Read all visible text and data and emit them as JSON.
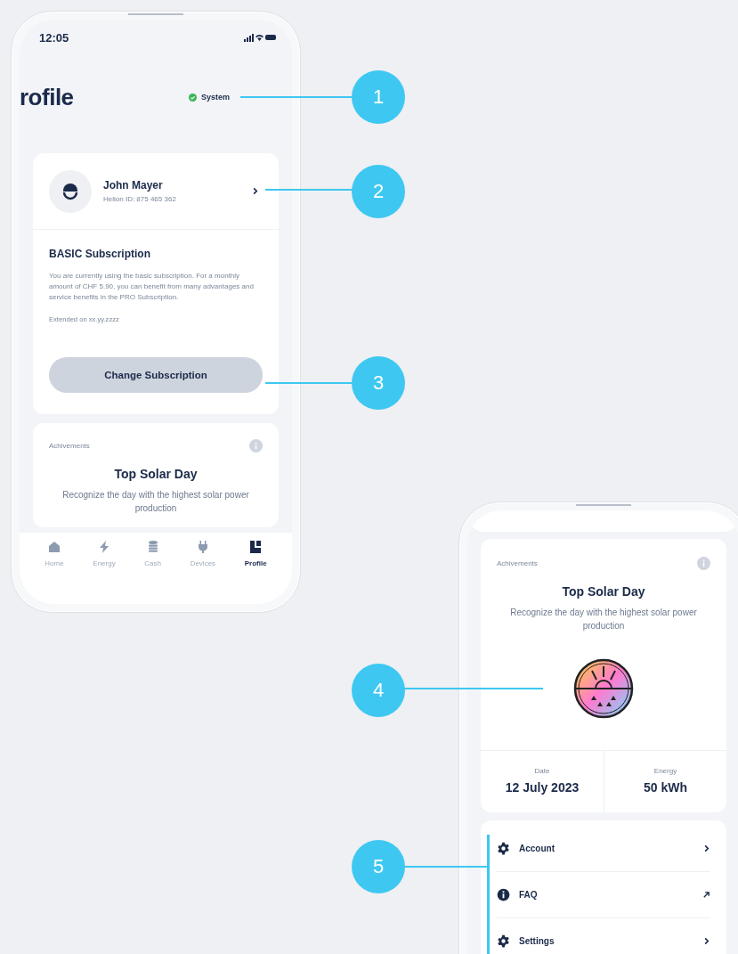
{
  "screen_1": {
    "status_bar": {
      "time": "12:05"
    },
    "title": "rofile",
    "system_status": {
      "label": "System",
      "ok": true
    },
    "profile": {
      "name": "John Mayer",
      "helion_id": "Helion ID: 875 465 362"
    },
    "subscription": {
      "title": "BASIC Subscription",
      "description": "You are currently using the basic subscription. For a monthly amount of CHF 5.90, you can benefit from many advantages and service benefits in the PRO Subscription.",
      "extended": "Extended on xx.yy.zzzz",
      "button": "Change Subscription"
    },
    "achievement": {
      "label": "Achivements",
      "title": "Top Solar Day",
      "description": "Recognize the day with the highest solar power production"
    },
    "tab_bar": [
      {
        "label": "Home",
        "kind": "home",
        "selected": false
      },
      {
        "label": "Energy",
        "kind": "energy",
        "selected": false
      },
      {
        "label": "Cash",
        "kind": "cash",
        "selected": false
      },
      {
        "label": "Devices",
        "kind": "devices",
        "selected": false
      },
      {
        "label": "Profile",
        "kind": "profile",
        "selected": true
      }
    ]
  },
  "screen_2": {
    "achievement": {
      "label": "Achivements",
      "title": "Top Solar Day",
      "description": "Recognize the day with the highest solar power production",
      "stats": [
        {
          "label": "Date",
          "value": "12 July 2023"
        },
        {
          "label": "Energy",
          "value": "50 kWh"
        }
      ]
    },
    "menu": [
      {
        "label": "Account",
        "kind": "account"
      },
      {
        "label": "FAQ",
        "kind": "external"
      },
      {
        "label": "Settings",
        "kind": "settings"
      }
    ]
  },
  "callouts": [
    {
      "label": "1"
    },
    {
      "label": "2"
    },
    {
      "label": "3"
    },
    {
      "label": "4"
    },
    {
      "label": "5"
    }
  ]
}
